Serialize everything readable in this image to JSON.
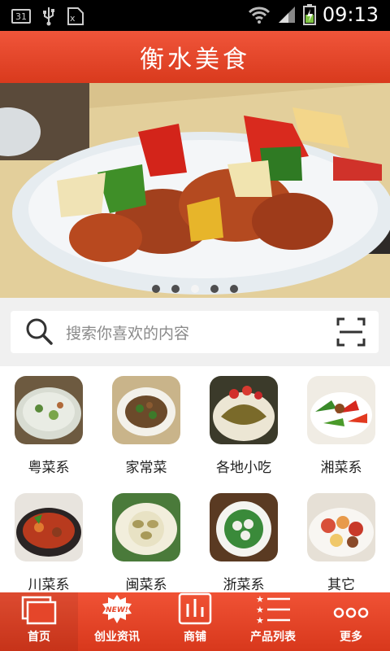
{
  "status_bar": {
    "notification_count": "31",
    "time": "09:13"
  },
  "header": {
    "title": "衡水美食"
  },
  "banner": {
    "slide_count": 5,
    "active_slide": 3
  },
  "search": {
    "placeholder": "搜索你喜欢的内容"
  },
  "categories": [
    {
      "label": "粤菜系",
      "icon": "congee-dish-photo"
    },
    {
      "label": "家常菜",
      "icon": "stirfry-dish-photo"
    },
    {
      "label": "各地小吃",
      "icon": "noodle-dish-photo"
    },
    {
      "label": "湘菜系",
      "icon": "pepper-dish-photo"
    },
    {
      "label": "川菜系",
      "icon": "hotpot-dish-photo"
    },
    {
      "label": "闽菜系",
      "icon": "abalone-dish-photo"
    },
    {
      "label": "浙菜系",
      "icon": "tofu-greens-dish-photo"
    },
    {
      "label": "其它",
      "icon": "platter-dish-photo"
    }
  ],
  "tabbar": {
    "tabs": [
      {
        "label": "首页",
        "icon": "home-pages-icon"
      },
      {
        "label": "创业资讯",
        "icon": "new-badge-icon"
      },
      {
        "label": "商铺",
        "icon": "store-chart-icon"
      },
      {
        "label": "产品列表",
        "icon": "star-list-icon"
      },
      {
        "label": "更多",
        "icon": "more-dots-icon"
      }
    ]
  },
  "colors": {
    "accent": "#e5462a",
    "background": "#f2f2f2"
  }
}
